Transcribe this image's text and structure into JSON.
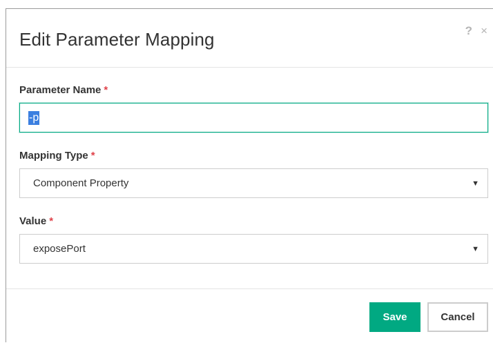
{
  "dialog": {
    "title": "Edit Parameter Mapping",
    "help_icon": "?",
    "close_icon": "×"
  },
  "fields": {
    "parameter_name": {
      "label": "Parameter Name",
      "required_mark": "*",
      "value": "-p"
    },
    "mapping_type": {
      "label": "Mapping Type",
      "required_mark": "*",
      "value": "Component Property",
      "icon": "chevron-down-icon"
    },
    "value": {
      "label": "Value",
      "required_mark": "*",
      "value": "exposePort",
      "icon": "chevron-down-icon"
    }
  },
  "footer": {
    "save_label": "Save",
    "cancel_label": "Cancel"
  },
  "colors": {
    "accent": "#01a982",
    "required": "#e0424a",
    "selection": "#3b7fe0"
  }
}
